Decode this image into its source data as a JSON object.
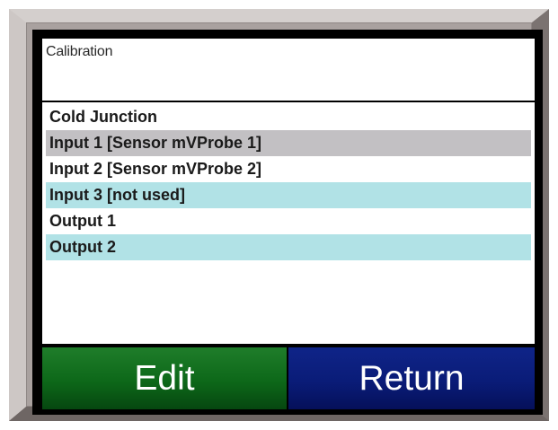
{
  "title": "Calibration",
  "list": {
    "items": [
      {
        "label": "Cold Junction",
        "style": "normal"
      },
      {
        "label": "Input 1 [Sensor mVProbe 1]",
        "style": "selected"
      },
      {
        "label": "Input 2 [Sensor mVProbe 2]",
        "style": "normal"
      },
      {
        "label": "Input 3 [not used]",
        "style": "alt"
      },
      {
        "label": "Output 1",
        "style": "normal"
      },
      {
        "label": "Output 2",
        "style": "alt"
      }
    ]
  },
  "buttons": {
    "edit_label": "Edit",
    "return_label": "Return"
  },
  "colors": {
    "selected_row": "#c2c0c3",
    "alt_row": "#b1e2e6",
    "edit_button": "#0d6819",
    "return_button": "#0a1c78"
  }
}
